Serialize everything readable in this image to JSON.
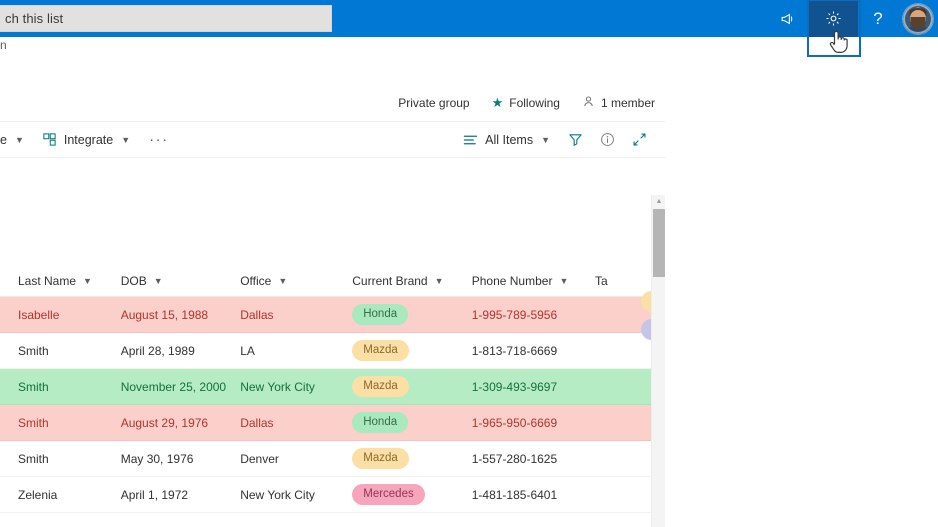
{
  "suite": {
    "search": {
      "value": "",
      "placeholder": "ch this list"
    },
    "icons": {
      "megaphone": "megaphone-icon",
      "settings": "gear-icon",
      "help": "?",
      "avatar": "user-avatar"
    }
  },
  "page": {
    "edge_fragment": "n"
  },
  "site_meta": {
    "privacy": "Private group",
    "following": "Following",
    "members": "1 member"
  },
  "command_bar": {
    "left": [
      {
        "label": "e",
        "icon": "",
        "has_chevron": true
      },
      {
        "label": "Integrate",
        "icon": "integrate-icon",
        "has_chevron": true
      }
    ],
    "overflow": "···",
    "view": {
      "label": "All Items",
      "icon": "list-view-icon",
      "has_chevron": true
    },
    "right_icons": [
      "filter-icon",
      "info-icon",
      "expand-icon"
    ]
  },
  "list": {
    "columns": [
      {
        "key": "last_name",
        "label": "Last Name"
      },
      {
        "key": "dob",
        "label": "DOB"
      },
      {
        "key": "office",
        "label": "Office"
      },
      {
        "key": "brand",
        "label": "Current Brand"
      },
      {
        "key": "phone",
        "label": "Phone Number"
      },
      {
        "key": "tags",
        "label": "Ta"
      }
    ],
    "rows": [
      {
        "last_name": "Isabelle",
        "dob": "August 15, 1988",
        "office": "Dallas",
        "brand": "Honda",
        "phone": "1-995-789-5956",
        "highlight": "pink"
      },
      {
        "last_name": "Smith",
        "dob": "April 28, 1989",
        "office": "LA",
        "brand": "Mazda",
        "phone": "1-813-718-6669",
        "highlight": "white"
      },
      {
        "last_name": "Smith",
        "dob": "November 25, 2000",
        "office": "New York City",
        "brand": "Mazda",
        "phone": "1-309-493-9697",
        "highlight": "green"
      },
      {
        "last_name": "Smith",
        "dob": "August 29, 1976",
        "office": "Dallas",
        "brand": "Honda",
        "phone": "1-965-950-6669",
        "highlight": "pink"
      },
      {
        "last_name": "Smith",
        "dob": "May 30, 1976",
        "office": "Denver",
        "brand": "Mazda",
        "phone": "1-557-280-1625",
        "highlight": "white"
      },
      {
        "last_name": "Zelenia",
        "dob": "April 1, 1972",
        "office": "New York City",
        "brand": "Mercedes",
        "phone": "1-481-185-6401",
        "highlight": "white"
      }
    ]
  },
  "colors": {
    "suite_bar": "#0078d4",
    "gear_selected_bg": "#105390",
    "gear_focus_border": "#0f6cbd",
    "accent_teal": "#03787c",
    "row_pink": "#fbcfca",
    "row_green": "#b6ecc4",
    "pill_honda": "#a8e9bd",
    "pill_mazda": "#fbdfa4",
    "pill_mercedes": "#f7a4bd"
  }
}
